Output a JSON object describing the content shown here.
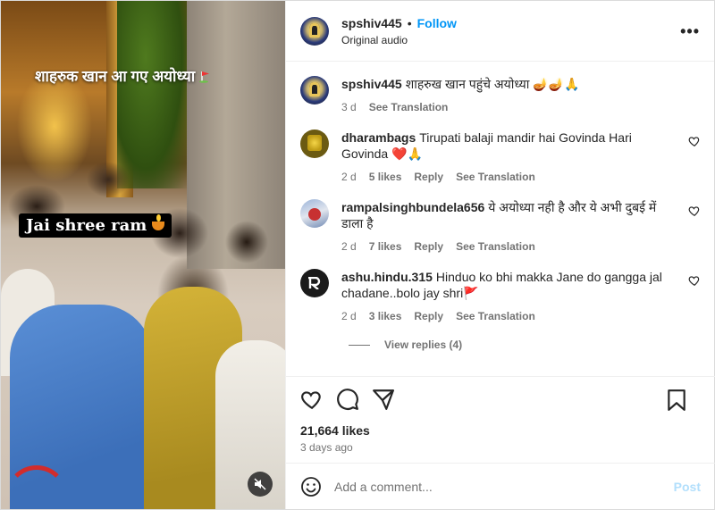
{
  "video": {
    "caption_top": "शाहरुक खान आ गए अयोध्या",
    "caption_sticker": "Jai shree ram"
  },
  "header": {
    "username": "spshiv445",
    "separator": "•",
    "follow_label": "Follow",
    "subtitle": "Original audio",
    "more_label": "•••"
  },
  "caption": {
    "username": "spshiv445",
    "text": "शाहरुख खान पहुंचे अयोध्या 🪔🪔🙏",
    "age": "3 d",
    "translation": "See Translation"
  },
  "comments": [
    {
      "username": "dharambags",
      "text": "Tirupati balaji mandir hai Govinda Hari Govinda ❤️🙏",
      "age": "2 d",
      "likes": "5 likes",
      "reply": "Reply",
      "translation": "See Translation"
    },
    {
      "username": "rampalsinghbundela656",
      "text": "ये अयोध्या नही है और ये अभी दुबई में डाला है",
      "age": "2 d",
      "likes": "7 likes",
      "reply": "Reply",
      "translation": "See Translation"
    },
    {
      "username": "ashu.hindu.315",
      "text": "Hinduo ko bhi makka Jane do gangga jal chadane..bolo jay shri🚩",
      "age": "2 d",
      "likes": "3 likes",
      "reply": "Reply",
      "translation": "See Translation",
      "view_replies": "View replies (4)"
    }
  ],
  "stats": {
    "likes": "21,664 likes",
    "posted": "3 days ago"
  },
  "add_comment": {
    "placeholder": "Add a comment...",
    "post_label": "Post"
  },
  "colors": {
    "accent": "#0095f6",
    "post_disabled": "#b2dffc",
    "muted": "#737373"
  }
}
